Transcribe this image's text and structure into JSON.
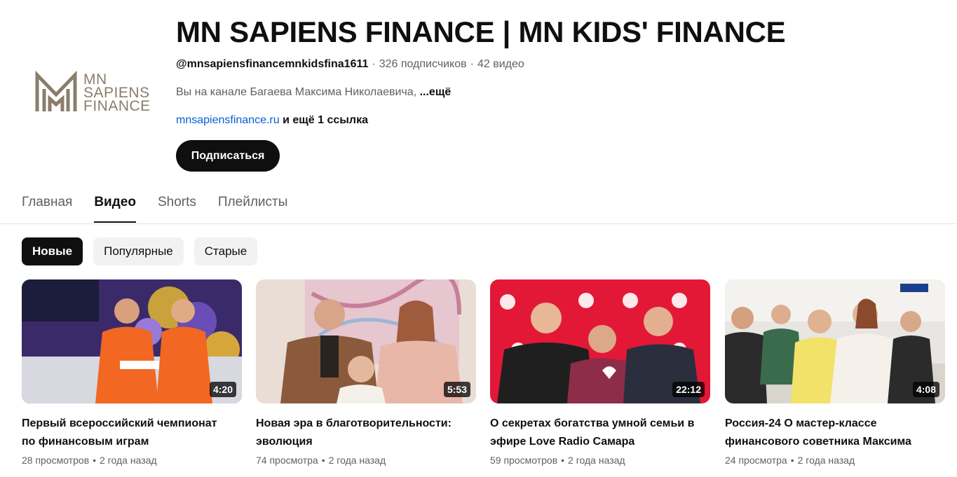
{
  "channel": {
    "logo_lines": [
      "MN",
      "SAPIENS",
      "FINANCE"
    ],
    "title": "MN SAPIENS FINANCE | MN KIDS' FINANCE",
    "handle": "@mnsapiensfinancemnkidsfina1611",
    "subscribers": "326 подписчиков",
    "video_count": "42 видео",
    "description": "Вы на канале Багаева Максима Николаевича,",
    "description_more": "...ещё",
    "link": "mnsapiensfinance.ru",
    "more_links": "и ещё 1 ссылка",
    "subscribe_label": "Подписаться"
  },
  "tabs": [
    {
      "label": "Главная",
      "active": false
    },
    {
      "label": "Видео",
      "active": true
    },
    {
      "label": "Shorts",
      "active": false
    },
    {
      "label": "Плейлисты",
      "active": false
    }
  ],
  "chips": [
    {
      "label": "Новые",
      "active": true
    },
    {
      "label": "Популярные",
      "active": false
    },
    {
      "label": "Старые",
      "active": false
    }
  ],
  "videos": [
    {
      "title": "Первый всероссийский чемпионат по финансовым играм",
      "duration": "4:20",
      "views": "28 просмотров",
      "age": "2 года назад"
    },
    {
      "title": "Новая эра в благотворительности: эволюция",
      "duration": "5:53",
      "views": "74 просмотра",
      "age": "2 года назад"
    },
    {
      "title": "О секретах богатства умной семьи в эфире Love Radio Самара",
      "duration": "22:12",
      "views": "59 просмотров",
      "age": "2 года назад"
    },
    {
      "title": "Россия-24 О мастер-классе финансового советника Максима",
      "duration": "4:08",
      "views": "24 просмотра",
      "age": "2 года назад"
    }
  ],
  "colors": {
    "accent_link": "#065fd4",
    "logo_gold": "#8a7d6a",
    "text_primary": "#0f0f0f",
    "text_secondary": "#606060"
  }
}
